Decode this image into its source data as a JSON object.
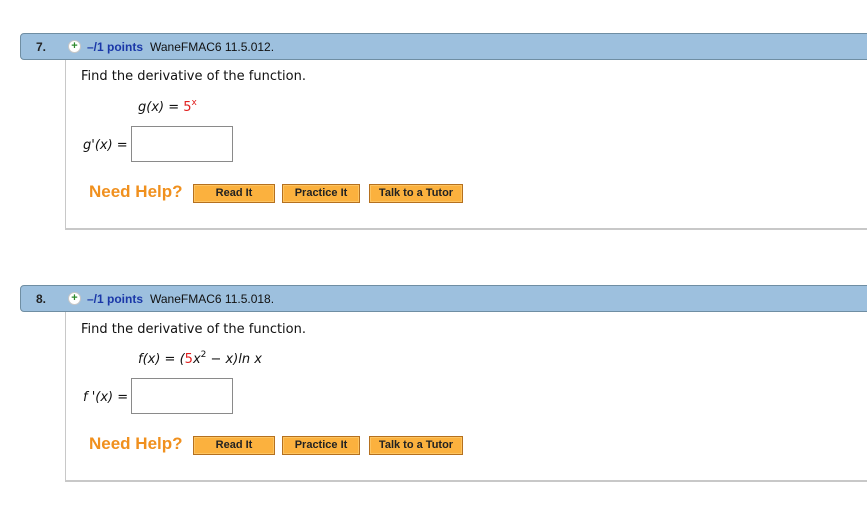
{
  "questions": [
    {
      "number": "7.",
      "points": "–/1 points",
      "reference": "WaneFMAC6 11.5.012.",
      "prompt": "Find the derivative of the function.",
      "function_lhs": "g(x) = ",
      "function_base": "5",
      "function_exp": "x",
      "answer_label": "g'(x) = ",
      "answer_value": "",
      "need_help": "Need Help?",
      "buttons": [
        "Read It",
        "Practice It",
        "Talk to a Tutor"
      ]
    },
    {
      "number": "8.",
      "points": "–/1 points",
      "reference": "WaneFMAC6 11.5.018.",
      "prompt": "Find the derivative of the function.",
      "function_lhs": "f(x) = (",
      "function_coef": "5",
      "function_var": "x",
      "function_exp": "2",
      "function_rest": " − x)ln x",
      "answer_label": "f '(x) = ",
      "answer_value": "",
      "need_help": "Need Help?",
      "buttons": [
        "Read It",
        "Practice It",
        "Talk to a Tutor"
      ]
    }
  ],
  "colors": {
    "header_bg": "#9dc0de",
    "points_text": "#1a37a8",
    "highlight_red": "#e0201f",
    "need_help": "#f0901e",
    "button_bg": "#fbb13e"
  }
}
